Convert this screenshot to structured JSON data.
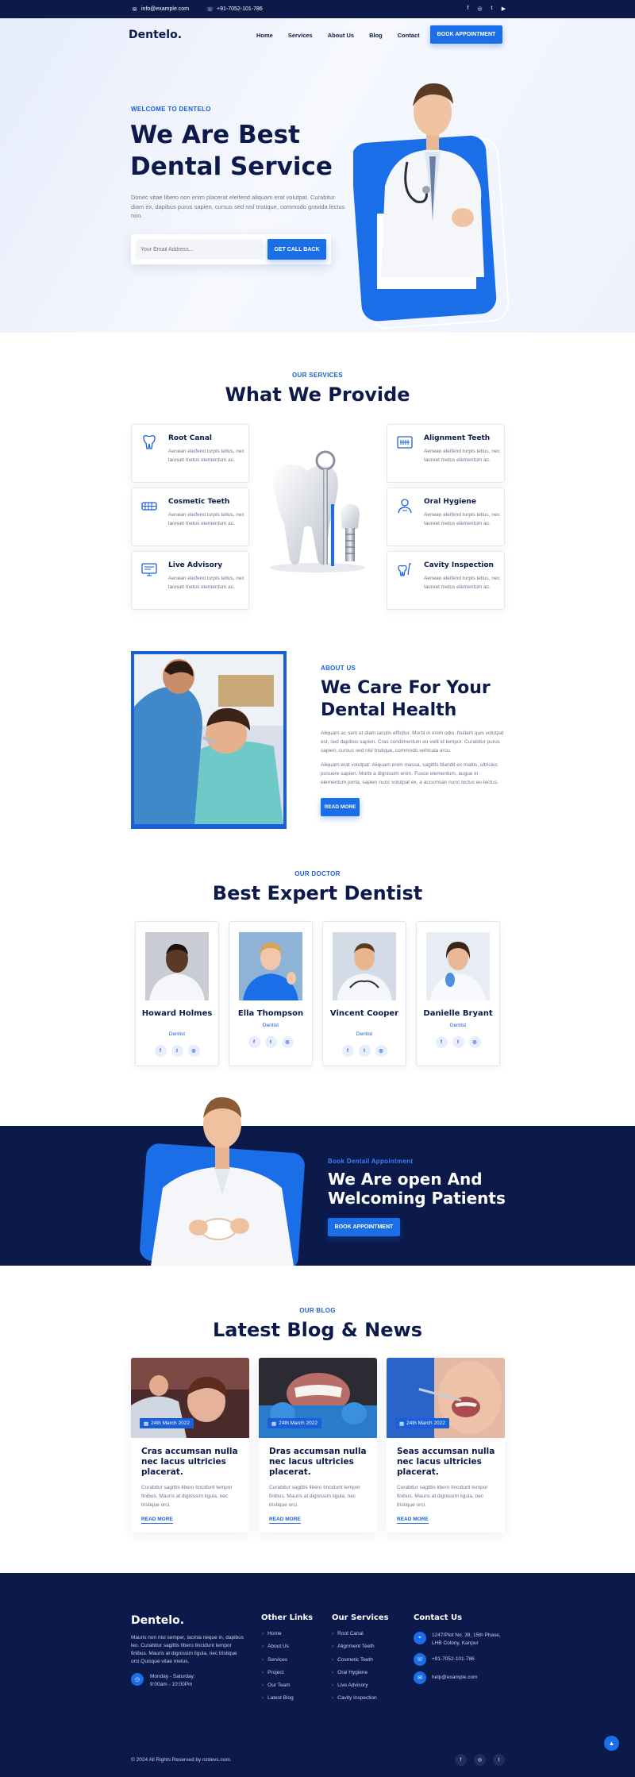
{
  "topbar": {
    "email": "info@example.com",
    "phone": "+91-7052-101-786",
    "social_icons": [
      "facebook-icon",
      "instagram-icon",
      "twitter-icon",
      "youtube-icon"
    ]
  },
  "nav": {
    "logo": "Dentelo.",
    "items": [
      "Home",
      "Services",
      "About Us",
      "Blog",
      "Contact"
    ],
    "cta": "BOOK APPOINTMENT"
  },
  "hero": {
    "eyebrow": "WELCOME TO DENTELO",
    "title_line1": "We Are Best",
    "title_line2": "Dental Service",
    "description": "Donec vitae libero non enim placerat eleifend aliquam erat volutpat. Curabitur diam ex, dapibus purus sapien, cursus sed nisl tristique, commodo gravida lectus non.",
    "email_placeholder": "Your Email Address...",
    "cta": "GET CALL BACK"
  },
  "services": {
    "eyebrow": "OUR SERVICES",
    "title": "What We Provide",
    "items": [
      {
        "title": "Root Canal",
        "text": "Aenean eleifend turpis tellus, nec laoreet metus elementum ac.",
        "icon": "root-canal-icon"
      },
      {
        "title": "Cosmetic Teeth",
        "text": "Aenean eleifend turpis tellus, nec laoreet metus elementum ac.",
        "icon": "cosmetic-teeth-icon"
      },
      {
        "title": "Live Advisory",
        "text": "Aenean eleifend turpis tellus, nec laoreet metus elementum ac.",
        "icon": "live-advisory-icon"
      },
      {
        "title": "Alignment Teeth",
        "text": "Aenean eleifend turpis tellus, nec laoreet metus elementum ac.",
        "icon": "alignment-teeth-icon"
      },
      {
        "title": "Oral Hygiene",
        "text": "Aenean eleifend turpis tellus, nec laoreet metus elementum ac.",
        "icon": "oral-hygiene-icon"
      },
      {
        "title": "Cavity Inspection",
        "text": "Aenean eleifend turpis tellus, nec laoreet metus elementum ac.",
        "icon": "cavity-inspection-icon"
      }
    ]
  },
  "about": {
    "eyebrow": "ABOUT US",
    "title_line1": "We Care For Your",
    "title_line2": "Dental Health",
    "p1": "Aliquam ac sem et diam iaculis efficitur. Morbi in enim odio. Nullam quis volutpat est, sed dapibus sapien. Cras condimentum eu velit id tempor. Curabitur purus sapien, cursus sed nisl tristique, commodo vehicula arcu.",
    "p2": "Aliquam erat volutpat. Aliquam enim massa, sagittis blandit ex mattis, ultricies posuere sapien. Morbi a dignissim enim. Fusce elementum, augue in elementum porta, sapien nunc volutpat ex, a accumsan nunc lectus eu lectus.",
    "cta": "READ MORE"
  },
  "doctors": {
    "eyebrow": "OUR DOCTOR",
    "title": "Best Expert Dentist",
    "items": [
      {
        "name": "Howard Holmes",
        "role": "Dentist"
      },
      {
        "name": "Ella Thompson",
        "role": "Dentist"
      },
      {
        "name": "Vincent Cooper",
        "role": "Dentist"
      },
      {
        "name": "Danielle Bryant",
        "role": "Dentist"
      }
    ]
  },
  "appointment": {
    "eyebrow": "Book Dentail Appointment",
    "title_line1": "We Are open And",
    "title_line2": "Welcoming Patients",
    "cta": "BOOK APPOINTMENT"
  },
  "blog": {
    "eyebrow": "OUR BLOG",
    "title": "Latest Blog & News",
    "posts": [
      {
        "date": "24th March 2022",
        "title": "Cras accumsan nulla nec lacus ultricies placerat.",
        "text": "Curabitur sagittis libero tincidunt tempor finibus. Mauris at dignissim ligula, nec tristique orci.",
        "more": "READ MORE"
      },
      {
        "date": "24th March 2022",
        "title": "Dras accumsan nulla nec lacus ultricies placerat.",
        "text": "Curabitur sagittis libero tincidunt tempor finibus. Mauris at dignissim ligula, nec tristique orci.",
        "more": "READ MORE"
      },
      {
        "date": "24th March 2022",
        "title": "Seas accumsan nulla nec lacus ultricies placerat.",
        "text": "Curabitur sagittis libero tincidunt tempor finibus. Mauris at dignissim ligula, nec tristique orci.",
        "more": "READ MORE"
      }
    ]
  },
  "footer": {
    "logo": "Dentelo.",
    "description": "Mauris non nisi semper, lacinia neque in, dapibus leo. Curabitur sagittis libero tincidunt tempor finibus. Mauris at dignissim ligula, nec tristique orci.Quisque vitae metus.",
    "hours_line1": "Monday - Saturday:",
    "hours_line2": "9:00am - 10:00Pm",
    "other_links_title": "Other Links",
    "other_links": [
      "Home",
      "About Us",
      "Services",
      "Project",
      "Our Team",
      "Latest Blog"
    ],
    "services_title": "Our Services",
    "services": [
      "Root Canal",
      "Alignment Teeth",
      "Cosmetic Teeth",
      "Oral Hygiene",
      "Live Advisory",
      "Cavity Inspection"
    ],
    "contact_title": "Contact Us",
    "address_line1": "1247/Plot No. 39, 15th Phase,",
    "address_line2": "LHB Colony, Kanpur",
    "phone": "+91-7052-101-786",
    "email": "help@example.com",
    "copyright": "© 2024 All Rights Reserved by nzdevs.com.",
    "social_icons": [
      "facebook-icon",
      "instagram-icon",
      "twitter-icon"
    ]
  },
  "colors": {
    "navy": "#0b1a4a",
    "accent": "#1a6ee8",
    "eyebrow": "#1a5fd8"
  }
}
